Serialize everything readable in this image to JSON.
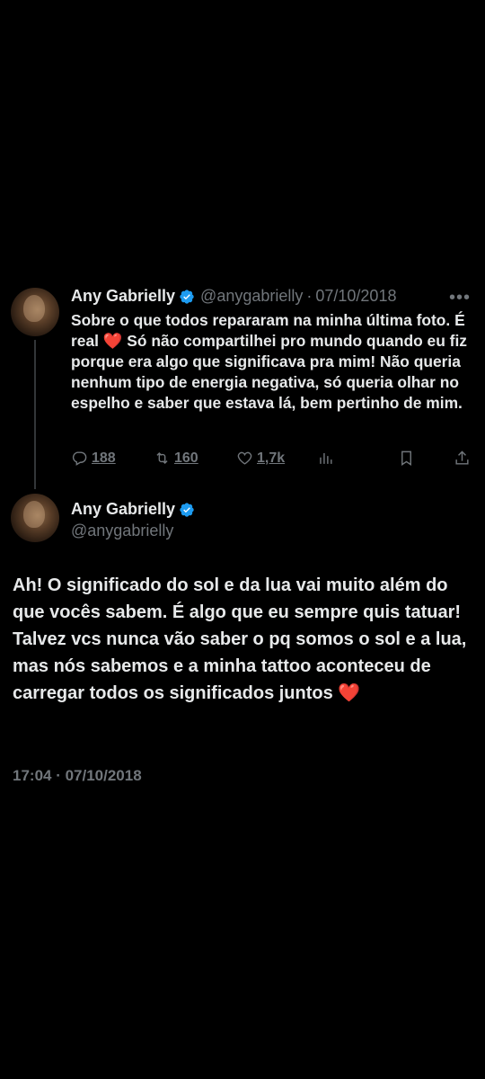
{
  "tweet1": {
    "name": "Any Gabrielly",
    "handle": "@anygabrielly",
    "separator": "·",
    "date": "07/10/2018",
    "more_icon": "more-horizontal-icon",
    "text_before_heart": "Sobre o que todos repararam na minha última foto. É real ",
    "heart": "❤️",
    "text_after_heart": " Só não compartilhei pro mundo quando eu fiz porque era algo que significava pra mim! Não queria nenhum tipo de energia negativa, só queria olhar no espelho e saber que estava lá, bem pertinho de mim.",
    "replies": "188",
    "retweets": "160",
    "likes": "1,7k"
  },
  "tweet2": {
    "name": "Any Gabrielly",
    "handle": "@anygabrielly",
    "text": "Ah! O significado do sol e da lua vai muito além do que vocês sabem. É algo que eu sempre quis tatuar! Talvez vcs nunca vão saber o pq somos o sol e a lua, mas nós sabemos e a minha tattoo aconteceu de carregar todos os significados juntos ",
    "heart": "❤️",
    "timestamp": "17:04 · 07/10/2018"
  },
  "colors": {
    "background": "#000000",
    "text": "#e7e9ea",
    "muted": "#71767b",
    "verified": "#1d9bf0",
    "heart": "#e8263f"
  }
}
